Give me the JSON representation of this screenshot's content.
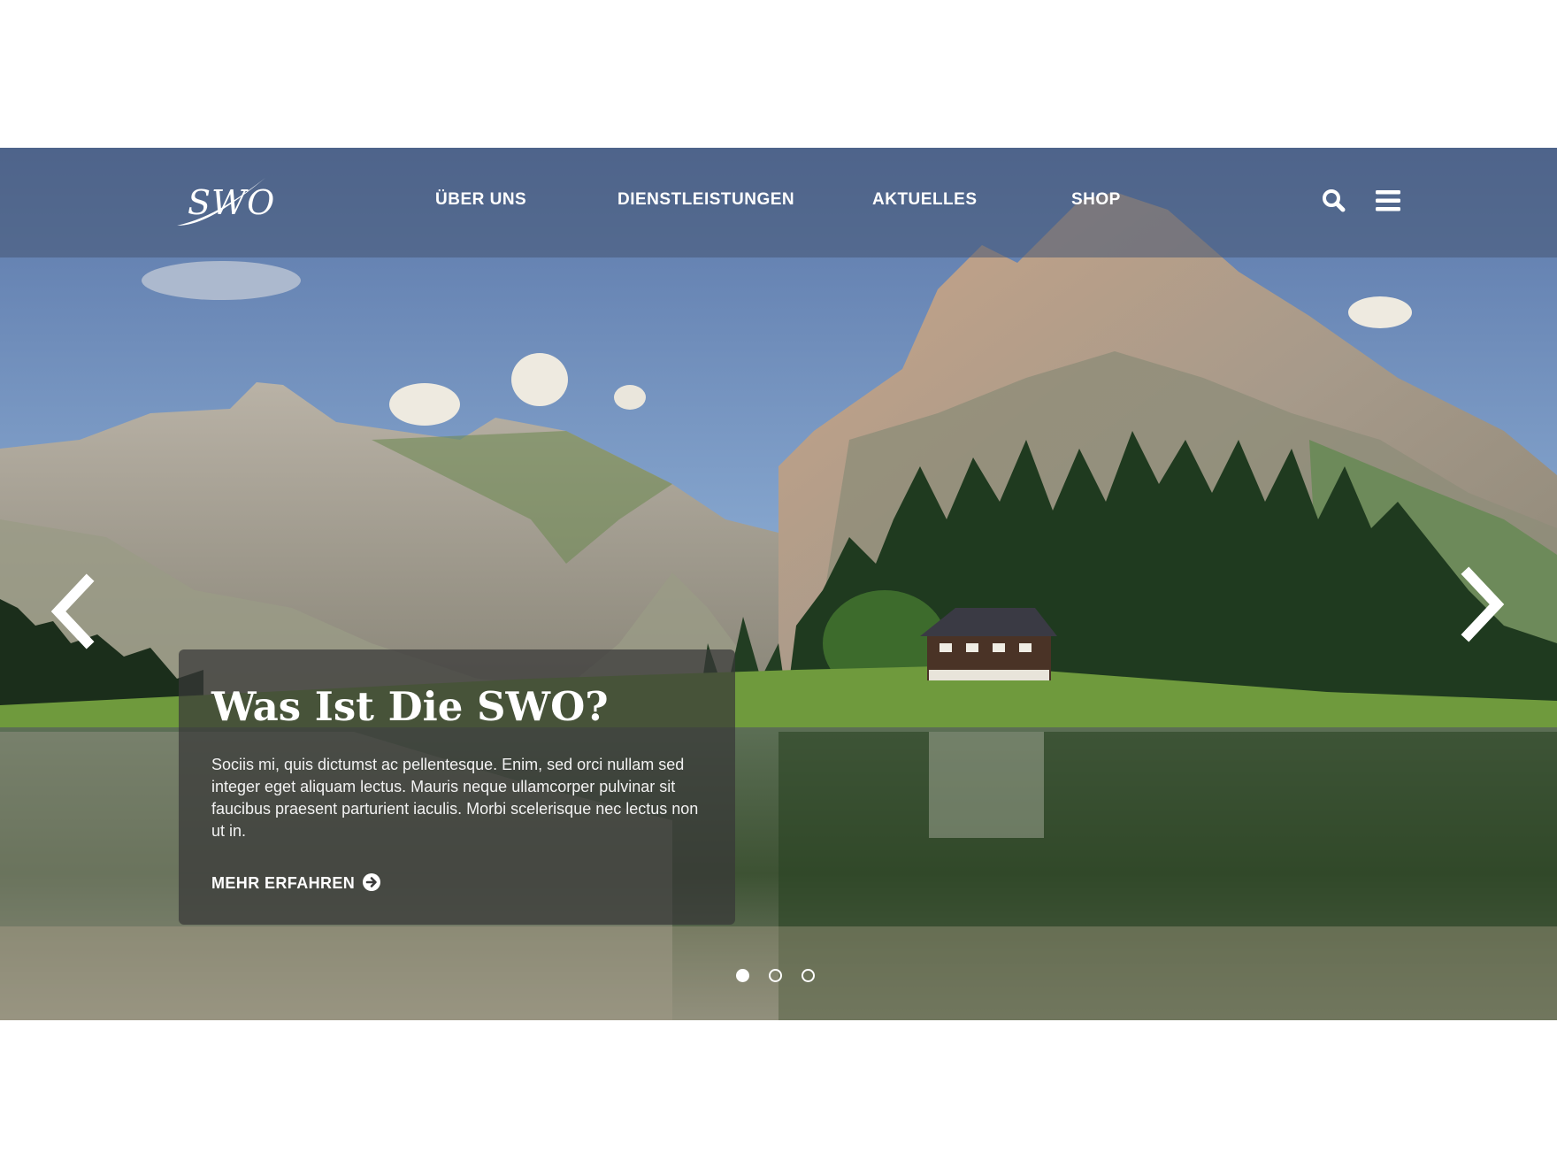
{
  "brand": {
    "logo_text": "SWO"
  },
  "nav": {
    "items": [
      {
        "label": "ÜBER UNS"
      },
      {
        "label": "DIENSTLEISTUNGEN"
      },
      {
        "label": "AKTUELLES"
      },
      {
        "label": "SHOP"
      }
    ],
    "search_icon": "search-icon",
    "menu_icon": "hamburger-menu-icon"
  },
  "slider": {
    "prev_icon": "chevron-left-icon",
    "next_icon": "chevron-right-icon",
    "background": "mountain lake landscape photo",
    "slides": 3,
    "active_slide": 1
  },
  "card": {
    "title": "Was Ist Die SWO?",
    "body": "Sociis mi, quis dictumst ac pellentesque. Enim, sed orci nullam sed integer eget aliquam lectus. Mauris neque ullamcorper pulvinar sit faucibus praesent parturient iaculis. Morbi scelerisque nec lectus non ut in.",
    "cta_label": "MEHR ERFAHREN",
    "cta_icon": "arrow-circle-right-icon"
  },
  "colors": {
    "nav_overlay": "#465573",
    "card_overlay": "#373737",
    "text": "#ffffff"
  }
}
